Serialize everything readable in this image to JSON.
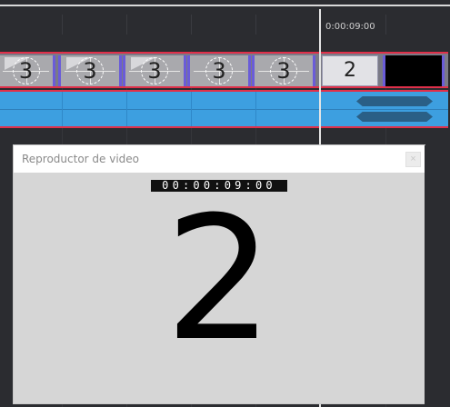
{
  "timeline": {
    "current_time_label": "0:00:09:00",
    "video_clips": [
      {
        "digit": "3"
      },
      {
        "digit": "3"
      },
      {
        "digit": "3"
      },
      {
        "digit": "3"
      },
      {
        "digit": "3"
      }
    ],
    "current_clip_digit": "2"
  },
  "player": {
    "title": "Reproductor de video",
    "close_glyph": "×",
    "timecode": "00:00:09:00",
    "frame_number": "2"
  },
  "colors": {
    "track_border": "#e0304a",
    "audio_track": "#3d9fe0",
    "clip_edge": "#6a5cd8"
  }
}
